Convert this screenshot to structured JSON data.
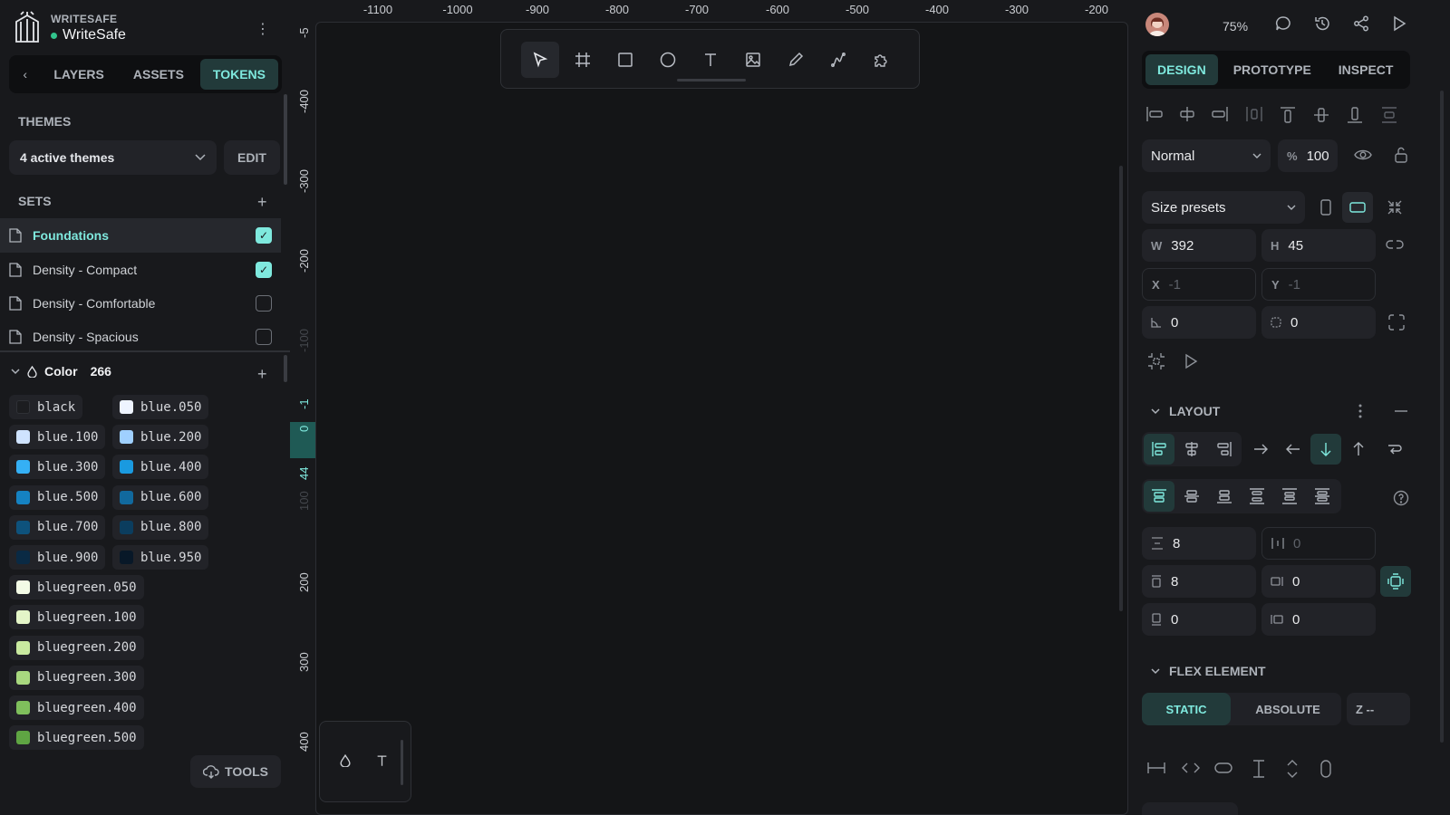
{
  "brand": {
    "team": "WRITESAFE",
    "project": "WriteSafe"
  },
  "left_tabs": {
    "layers": "LAYERS",
    "assets": "ASSETS",
    "tokens": "TOKENS"
  },
  "themes": {
    "label": "THEMES",
    "selected": "4 active themes",
    "edit": "EDIT"
  },
  "sets": {
    "label": "SETS",
    "items": [
      {
        "name": "Foundations",
        "checked": true
      },
      {
        "name": "Density - Compact",
        "checked": true
      },
      {
        "name": "Density - Comfortable",
        "checked": false
      },
      {
        "name": "Density - Spacious",
        "checked": false
      }
    ]
  },
  "color_group": {
    "label": "Color",
    "count": "266"
  },
  "tokens": [
    {
      "name": "black",
      "color": "#1c1d20"
    },
    {
      "name": "blue.050",
      "color": "#eef4ff"
    },
    {
      "name": "blue.100",
      "color": "#cfe3ff"
    },
    {
      "name": "blue.200",
      "color": "#9fd0ff"
    },
    {
      "name": "blue.300",
      "color": "#35b0f5"
    },
    {
      "name": "blue.400",
      "color": "#1a9ae0"
    },
    {
      "name": "blue.500",
      "color": "#1582c2"
    },
    {
      "name": "blue.600",
      "color": "#11699e"
    },
    {
      "name": "blue.700",
      "color": "#0e527c"
    },
    {
      "name": "blue.800",
      "color": "#0b3d5e"
    },
    {
      "name": "blue.900",
      "color": "#0a2a44"
    },
    {
      "name": "blue.950",
      "color": "#081828"
    },
    {
      "name": "bluegreen.050",
      "color": "#f3fbe6"
    },
    {
      "name": "bluegreen.100",
      "color": "#e4f5c8"
    },
    {
      "name": "bluegreen.200",
      "color": "#c9eaa0"
    },
    {
      "name": "bluegreen.300",
      "color": "#a8d87f"
    },
    {
      "name": "bluegreen.400",
      "color": "#7fbf5c"
    },
    {
      "name": "bluegreen.500",
      "color": "#5fa543"
    }
  ],
  "tools_button": "TOOLS",
  "hruler": [
    "-1100",
    "-1000",
    "-900",
    "-800",
    "-700",
    "-600",
    "-500",
    "-400",
    "-300",
    "-200"
  ],
  "vruler": [
    "-5",
    "-400",
    "-300",
    "-200",
    "-100",
    "-1",
    "0",
    "44",
    "100",
    "200",
    "300",
    "400"
  ],
  "zoom": "75%",
  "right_tabs": {
    "design": "DESIGN",
    "prototype": "PROTOTYPE",
    "inspect": "INSPECT"
  },
  "blend": {
    "mode": "Normal",
    "opacity_symbol": "%",
    "opacity": "100"
  },
  "size_presets": "Size presets",
  "measures": {
    "w_label": "W",
    "w": "392",
    "h_label": "H",
    "h": "45",
    "x_label": "X",
    "x": "-1",
    "y_label": "Y",
    "y": "-1",
    "rotation": "0",
    "radius": "0"
  },
  "layout": {
    "title": "LAYOUT",
    "row_gap": "8",
    "col_gap": "0",
    "padding_top": "8",
    "padding_right": "0",
    "padding_bottom": "0",
    "padding_left": "0"
  },
  "flex_element": {
    "title": "FLEX ELEMENT",
    "static": "STATIC",
    "absolute": "ABSOLUTE",
    "z": "Z --"
  },
  "accent": "#7fe9de"
}
